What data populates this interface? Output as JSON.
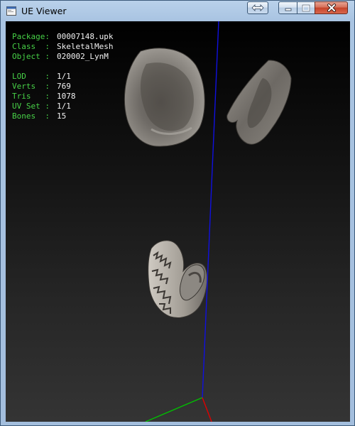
{
  "window": {
    "title": "UE Viewer",
    "controls": {
      "restore_icon": "double-arrow-icon",
      "minimize_icon": "minimize-icon",
      "maximize_icon": "maximize-icon",
      "close_icon": "close-icon"
    }
  },
  "info": {
    "package": {
      "label": "Package:",
      "value": "00007148.upk"
    },
    "class": {
      "label": "Class  :",
      "value": "SkeletalMesh"
    },
    "object": {
      "label": "Object :",
      "value": "020002_LynM"
    },
    "lod": {
      "label": "LOD    :",
      "value": "1/1"
    },
    "verts": {
      "label": "Verts  :",
      "value": "769"
    },
    "tris": {
      "label": "Tris   :",
      "value": "1078"
    },
    "uvset": {
      "label": "UV Set :",
      "value": "1/1"
    },
    "bones": {
      "label": "Bones  :",
      "value": "15"
    }
  },
  "scene": {
    "meshes": [
      "left-ear",
      "right-ear",
      "tail"
    ],
    "axis_colors": {
      "x": "#e00000",
      "y": "#00c000",
      "z": "#1010e0"
    },
    "label_color": "#47d147",
    "value_color": "#f2f2f2"
  }
}
